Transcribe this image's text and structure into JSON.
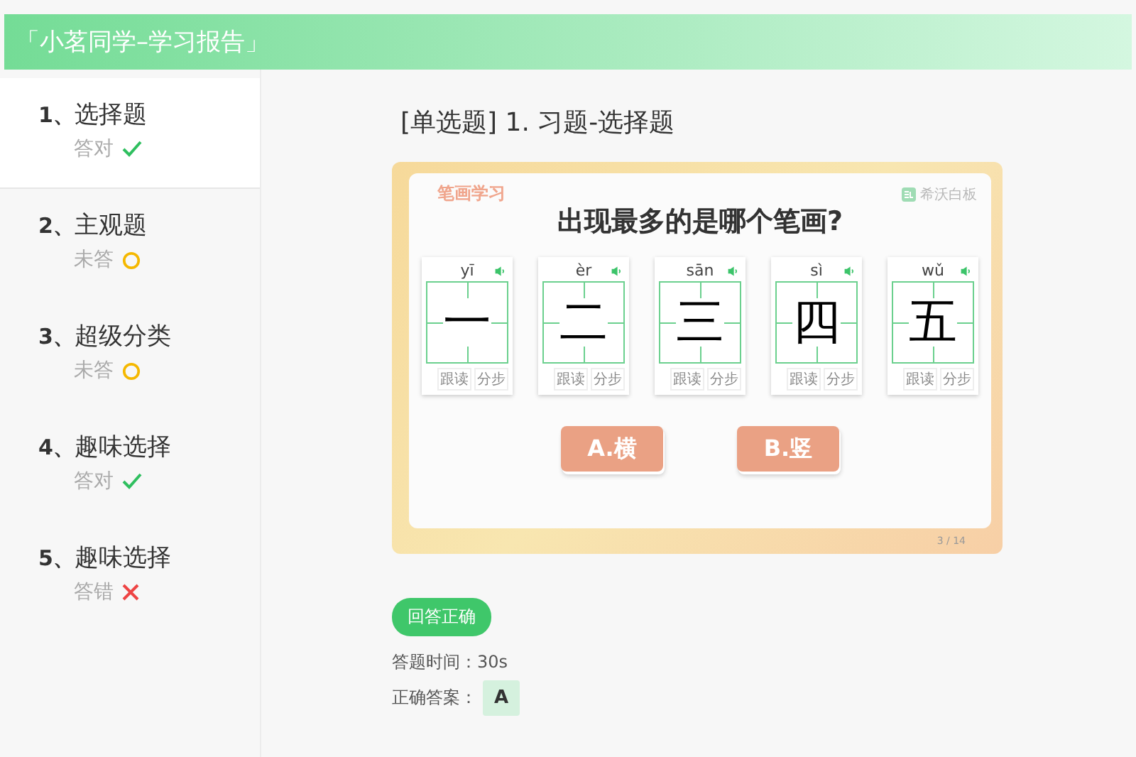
{
  "header": {
    "title": "「小茗同学–学习报告」"
  },
  "sidebar": {
    "items": [
      {
        "number": "1、",
        "title": "选择题",
        "status": "答对",
        "kind": "correct",
        "selected": true
      },
      {
        "number": "2、",
        "title": "主观题",
        "status": "未答",
        "kind": "unanswered",
        "selected": false
      },
      {
        "number": "3、",
        "title": "超级分类",
        "status": "未答",
        "kind": "unanswered",
        "selected": false
      },
      {
        "number": "4、",
        "title": "趣味选择",
        "status": "答对",
        "kind": "correct",
        "selected": false
      },
      {
        "number": "5、",
        "title": "趣味选择",
        "status": "答错",
        "kind": "wrong",
        "selected": false
      }
    ]
  },
  "question": {
    "title": "[单选题] 1. 习题-选择题"
  },
  "slide": {
    "tag": "笔画学习",
    "logo": "希沃白板",
    "heading": "出现最多的是哪个笔画?",
    "cards": [
      {
        "pinyin": "yī",
        "char": "一",
        "buttons": [
          "跟读",
          "分步"
        ]
      },
      {
        "pinyin": "èr",
        "char": "二",
        "buttons": [
          "跟读",
          "分步"
        ]
      },
      {
        "pinyin": "sān",
        "char": "三",
        "buttons": [
          "跟读",
          "分步"
        ]
      },
      {
        "pinyin": "sì",
        "char": "四",
        "buttons": [
          "跟读",
          "分步"
        ]
      },
      {
        "pinyin": "wǔ",
        "char": "五",
        "buttons": [
          "跟读",
          "分步"
        ]
      }
    ],
    "options": [
      "A.横",
      "B.竖"
    ],
    "page": "3 / 14"
  },
  "result": {
    "badge": "回答正确",
    "time_label": "答题时间：30s",
    "answer_label": "正确答案：",
    "answer": "A"
  }
}
